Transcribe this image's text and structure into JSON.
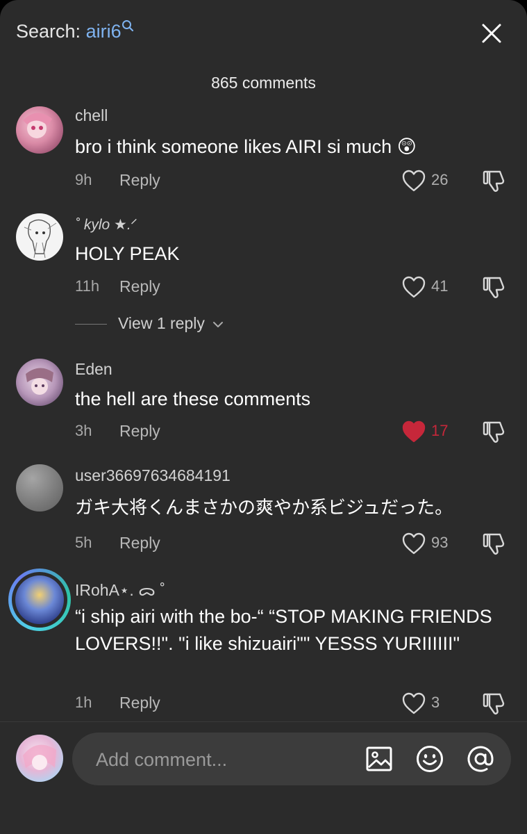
{
  "header": {
    "search_prefix": "Search:",
    "search_term": "airi6",
    "close_icon": "close-icon",
    "comment_count": "865 comments"
  },
  "comments": [
    {
      "username": "chell",
      "text": "bro i think someone likes AIRI si much 😲",
      "time": "9h",
      "reply_label": "Reply",
      "likes": "26",
      "liked": false
    },
    {
      "username": "˚ kylo ★.ᐟ",
      "text": "HOLY PEAK",
      "time": "11h",
      "reply_label": "Reply",
      "likes": "41",
      "liked": false,
      "view_replies": "View 1 reply"
    },
    {
      "username": "Eden",
      "text": "the hell are these comments",
      "time": "3h",
      "reply_label": "Reply",
      "likes": "17",
      "liked": true
    },
    {
      "username": "user36697634684191",
      "text": "ガキ大将くんまさかの爽やか系ビジュだった。",
      "time": "5h",
      "reply_label": "Reply",
      "likes": "93",
      "liked": false
    },
    {
      "username": "IRohA⋆. ᯅ ˚",
      "text": "“i ship airi with the bo-“ “STOP MAKING FRIENDS LOVERS!!\". \"i like shizuairi\"\" YESSS YURIIIIII\"",
      "time": "1h",
      "reply_label": "Reply",
      "likes": "3",
      "liked": false
    }
  ],
  "composer": {
    "placeholder": "Add comment...",
    "icons": [
      "image-icon",
      "emoji-icon",
      "mention-icon"
    ]
  },
  "colors": {
    "background": "#2b2b2b",
    "search_term": "#7fb3f0",
    "liked_heart": "#c6273a"
  }
}
